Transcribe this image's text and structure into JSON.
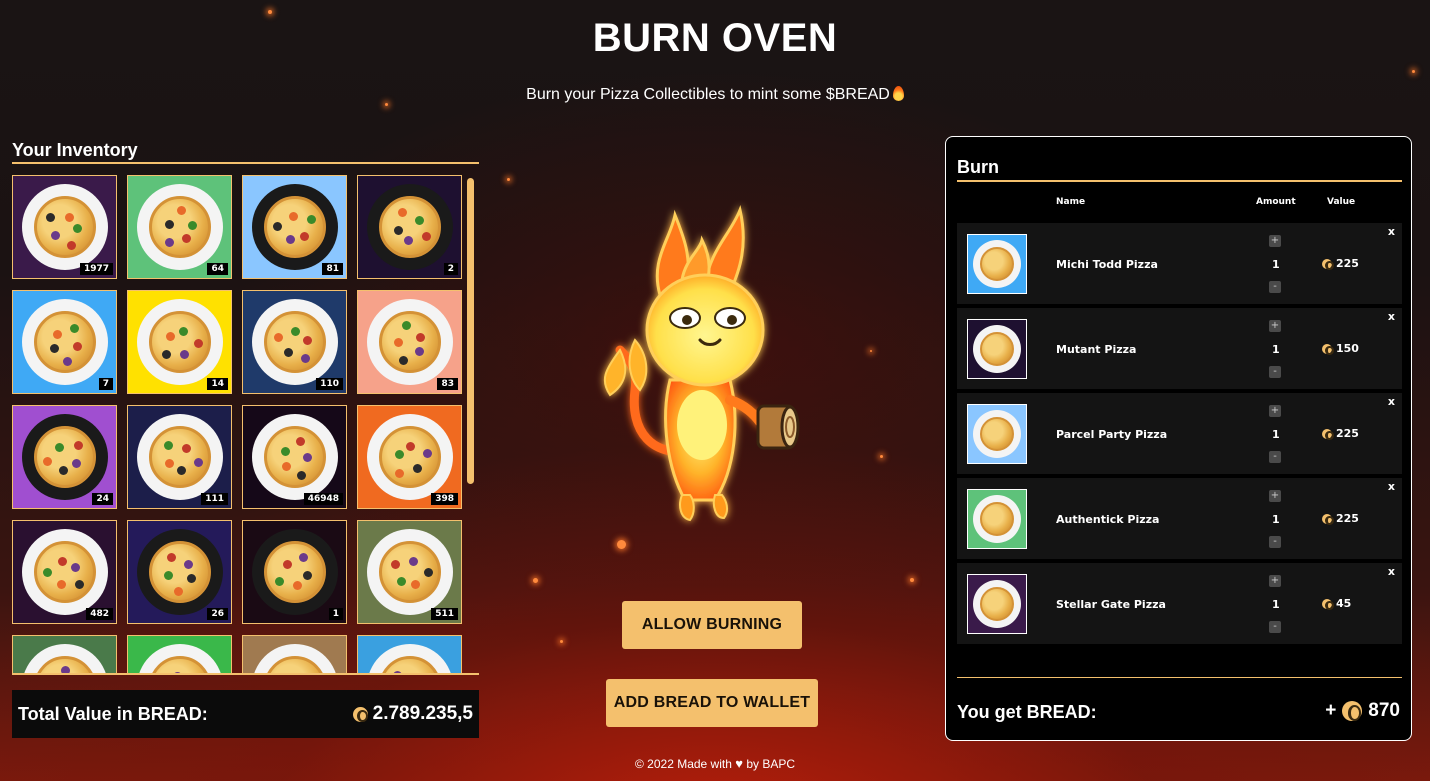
{
  "header": {
    "title": "BURN OVEN",
    "subtitle": "Burn your Pizza Collectibles to mint some $BREAD"
  },
  "inventory": {
    "title": "Your Inventory",
    "items": [
      {
        "count": "1977",
        "bg": "#3a1a4a"
      },
      {
        "count": "64",
        "bg": "#5ec27a"
      },
      {
        "count": "81",
        "bg": "#8ac6ff"
      },
      {
        "count": "2",
        "bg": "#1e1030"
      },
      {
        "count": "7",
        "bg": "#3fa9f5"
      },
      {
        "count": "14",
        "bg": "#ffe100"
      },
      {
        "count": "110",
        "bg": "#1f3a6a"
      },
      {
        "count": "83",
        "bg": "#f6a28a"
      },
      {
        "count": "24",
        "bg": "#a04fd0"
      },
      {
        "count": "111",
        "bg": "#1c1e4a"
      },
      {
        "count": "46948",
        "bg": "#150818"
      },
      {
        "count": "398",
        "bg": "#f06a20"
      },
      {
        "count": "482",
        "bg": "#2a1030"
      },
      {
        "count": "26",
        "bg": "#241a5a"
      },
      {
        "count": "1",
        "bg": "#1a0a14"
      },
      {
        "count": "511",
        "bg": "#6b7a4a"
      },
      {
        "count": "",
        "bg": "#4a7a4a"
      },
      {
        "count": "",
        "bg": "#3ab84a"
      },
      {
        "count": "",
        "bg": "#a07a50"
      },
      {
        "count": "",
        "bg": "#3aa0e0"
      }
    ],
    "total_label": "Total Value in BREAD:",
    "total_value": "2.789.235,5"
  },
  "actions": {
    "allow_label": "ALLOW BURNING",
    "add_bread_label": "ADD BREAD TO WALLET"
  },
  "footer": {
    "before": "© 2022 Made with",
    "after": "by BAPC"
  },
  "burn": {
    "title": "Burn",
    "col_name": "Name",
    "col_amount": "Amount",
    "col_value": "Value",
    "remove_label": "x",
    "plus_label": "+",
    "minus_label": "-",
    "rows": [
      {
        "name": "Michi Todd Pizza",
        "amount": "1",
        "value": "225",
        "bg": "#3fa9f5"
      },
      {
        "name": "Mutant Pizza",
        "amount": "1",
        "value": "150",
        "bg": "#1e1030"
      },
      {
        "name": "Parcel Party Pizza",
        "amount": "1",
        "value": "225",
        "bg": "#8ac6ff"
      },
      {
        "name": "Authentick Pizza",
        "amount": "1",
        "value": "225",
        "bg": "#5ec27a"
      },
      {
        "name": "Stellar Gate Pizza",
        "amount": "1",
        "value": "45",
        "bg": "#3a1a4a"
      }
    ],
    "get_label": "You get BREAD:",
    "get_prefix": "+",
    "get_value": "870"
  },
  "colors": {
    "accent": "#f4c06d",
    "panel_bg": "#000000",
    "row_bg": "#141414"
  }
}
